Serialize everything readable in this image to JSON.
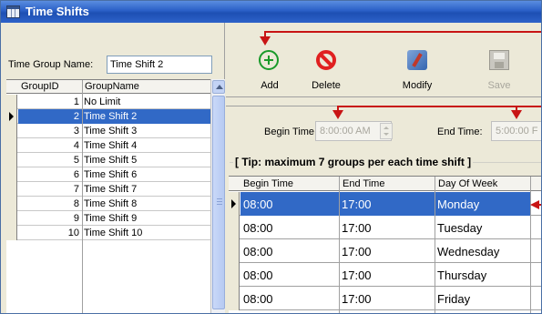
{
  "window": {
    "title": "Time Shifts"
  },
  "time_group": {
    "label": "Time Group Name:",
    "value": "Time Shift 2"
  },
  "groups_grid": {
    "headers": [
      "GroupID",
      "GroupName"
    ],
    "rows": [
      {
        "id": "1",
        "name": "No Limit"
      },
      {
        "id": "2",
        "name": "Time Shift 2"
      },
      {
        "id": "3",
        "name": "Time Shift 3"
      },
      {
        "id": "4",
        "name": "Time Shift 4"
      },
      {
        "id": "5",
        "name": "Time Shift 5"
      },
      {
        "id": "6",
        "name": "Time Shift 6"
      },
      {
        "id": "7",
        "name": "Time Shift 7"
      },
      {
        "id": "8",
        "name": "Time Shift 8"
      },
      {
        "id": "9",
        "name": "Time Shift 9"
      },
      {
        "id": "10",
        "name": "Time Shift 10"
      }
    ],
    "selected_index": 1
  },
  "toolbar": {
    "add": "Add",
    "delete": "Delete",
    "modify": "Modify",
    "save": "Save"
  },
  "times": {
    "begin_label": "Begin Time:",
    "begin_value": "8:00:00 AM",
    "end_label": "End Time:",
    "end_value": "5:00:00 F"
  },
  "tip": "[ Tip: maximum 7 groups per each time shift ]",
  "shifts_grid": {
    "headers": [
      "Begin Time",
      "End Time",
      "Day Of Week"
    ],
    "rows": [
      {
        "begin": "08:00",
        "end": "17:00",
        "day": "Monday"
      },
      {
        "begin": "08:00",
        "end": "17:00",
        "day": "Tuesday"
      },
      {
        "begin": "08:00",
        "end": "17:00",
        "day": "Wednesday"
      },
      {
        "begin": "08:00",
        "end": "17:00",
        "day": "Thursday"
      },
      {
        "begin": "08:00",
        "end": "17:00",
        "day": "Friday"
      }
    ],
    "selected_index": 0
  },
  "colors": {
    "selection": "#3169c6",
    "annotation": "#c81414",
    "titlebar": "#2a5fc6"
  },
  "icons": {
    "window": "grid-table-icon",
    "add": "plus-circle-icon",
    "delete": "no-entry-icon",
    "modify": "tools-icon",
    "save": "floppy-disk-icon"
  }
}
